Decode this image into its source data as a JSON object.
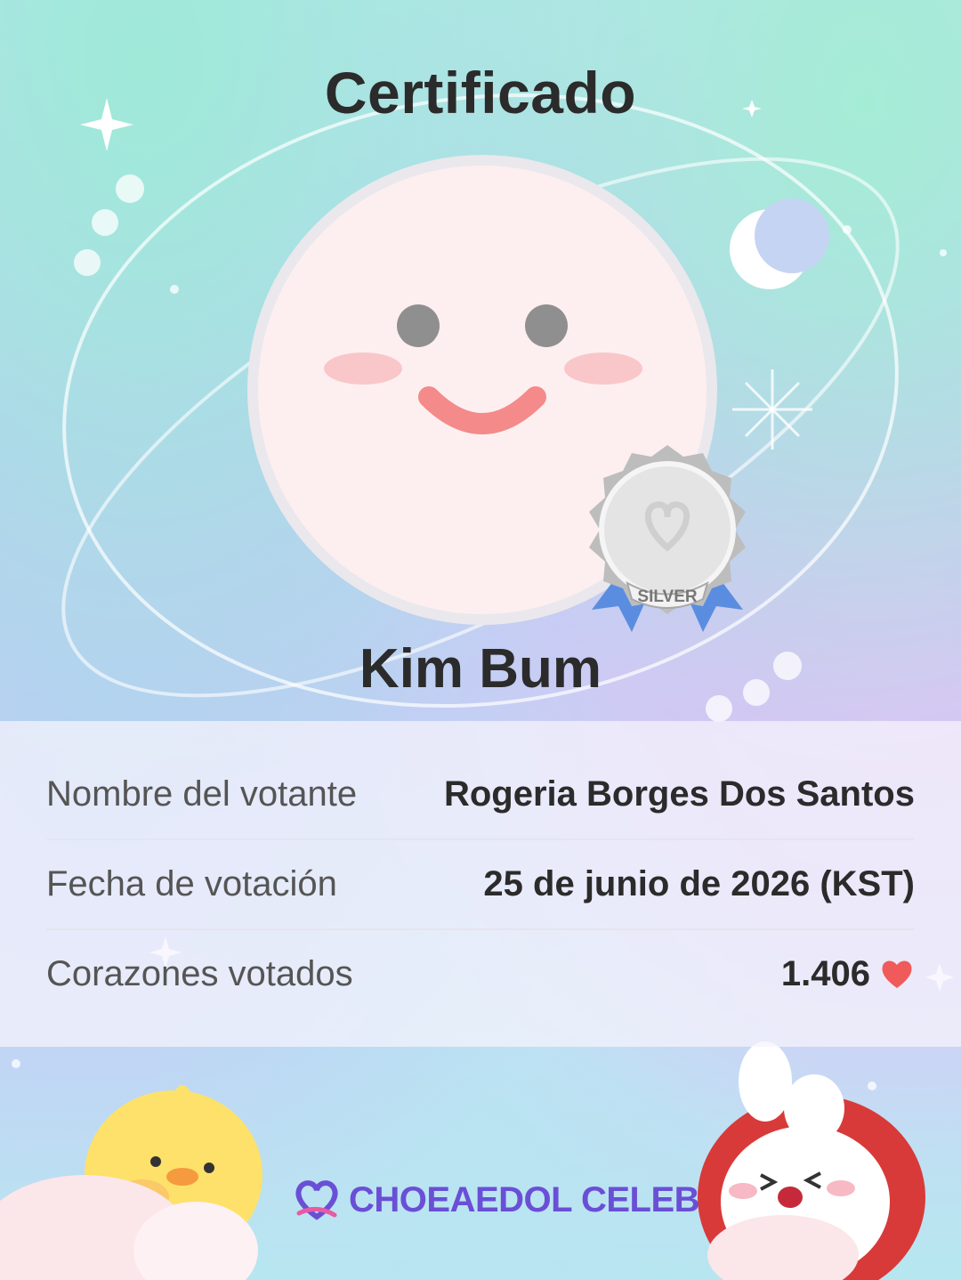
{
  "title": "Certificado",
  "celebrity_name": "Kim Bum",
  "badge": {
    "tier": "SILVER"
  },
  "info": {
    "rows": [
      {
        "label": "Nombre del votante",
        "value": "Rogeria Borges Dos Santos"
      },
      {
        "label": "Fecha de votación",
        "value": "25 de junio de 2026 (KST)"
      },
      {
        "label": "Corazones votados",
        "value": "1.406"
      }
    ]
  },
  "brand": {
    "name": "CHOEAEDOL CELEB"
  },
  "icons": {
    "vote_heart": "heart-icon",
    "brand_logo": "choeaedol-logo-icon",
    "moon": "crescent-moon-icon",
    "sparkle": "sparkle-icon"
  },
  "colors": {
    "heart": "#f05a5a",
    "brand": "#6a4fd6",
    "text_dark": "#2b2b2b",
    "badge_ribbon": "#5a8de0"
  }
}
